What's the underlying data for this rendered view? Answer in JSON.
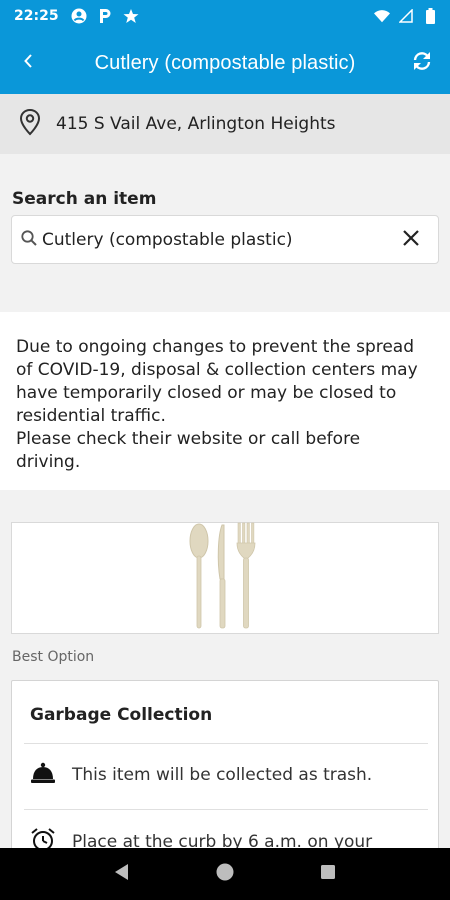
{
  "status_bar": {
    "time": "22:25",
    "left_icons": [
      "account-circle-icon",
      "parking-icon",
      "star-icon"
    ],
    "right_icons": [
      "wifi-icon",
      "cell-signal-icon",
      "battery-icon"
    ]
  },
  "app_bar": {
    "title": "Cutlery (compostable plastic)",
    "back_icon": "chevron-left-icon",
    "refresh_icon": "refresh-icon"
  },
  "address": {
    "text": "415 S Vail Ave, Arlington Heights",
    "icon": "location-pin-icon"
  },
  "search": {
    "label": "Search an item",
    "value": "Cutlery (compostable plastic)",
    "icon": "search-icon",
    "clear_icon": "close-icon"
  },
  "notice": {
    "lines": [
      "Due to ongoing changes to prevent the spread",
      "of COVID-19, disposal & collection centers may",
      "have temporarily closed or may be closed to",
      "residential traffic.",
      "Please check their website or call before",
      "driving."
    ]
  },
  "item_image": {
    "icon": "cutlery-image"
  },
  "best_option": {
    "label": "Best Option",
    "card_title": "Garbage Collection",
    "rows": [
      {
        "icon": "bell-icon",
        "text": "This item will be collected as trash."
      },
      {
        "icon": "alarm-clock-icon",
        "text": "Place at the curb by 6 a.m. on your"
      }
    ]
  },
  "nav_bar": {
    "back_icon": "nav-back-icon",
    "home_icon": "nav-home-icon",
    "recents_icon": "nav-recents-icon"
  }
}
